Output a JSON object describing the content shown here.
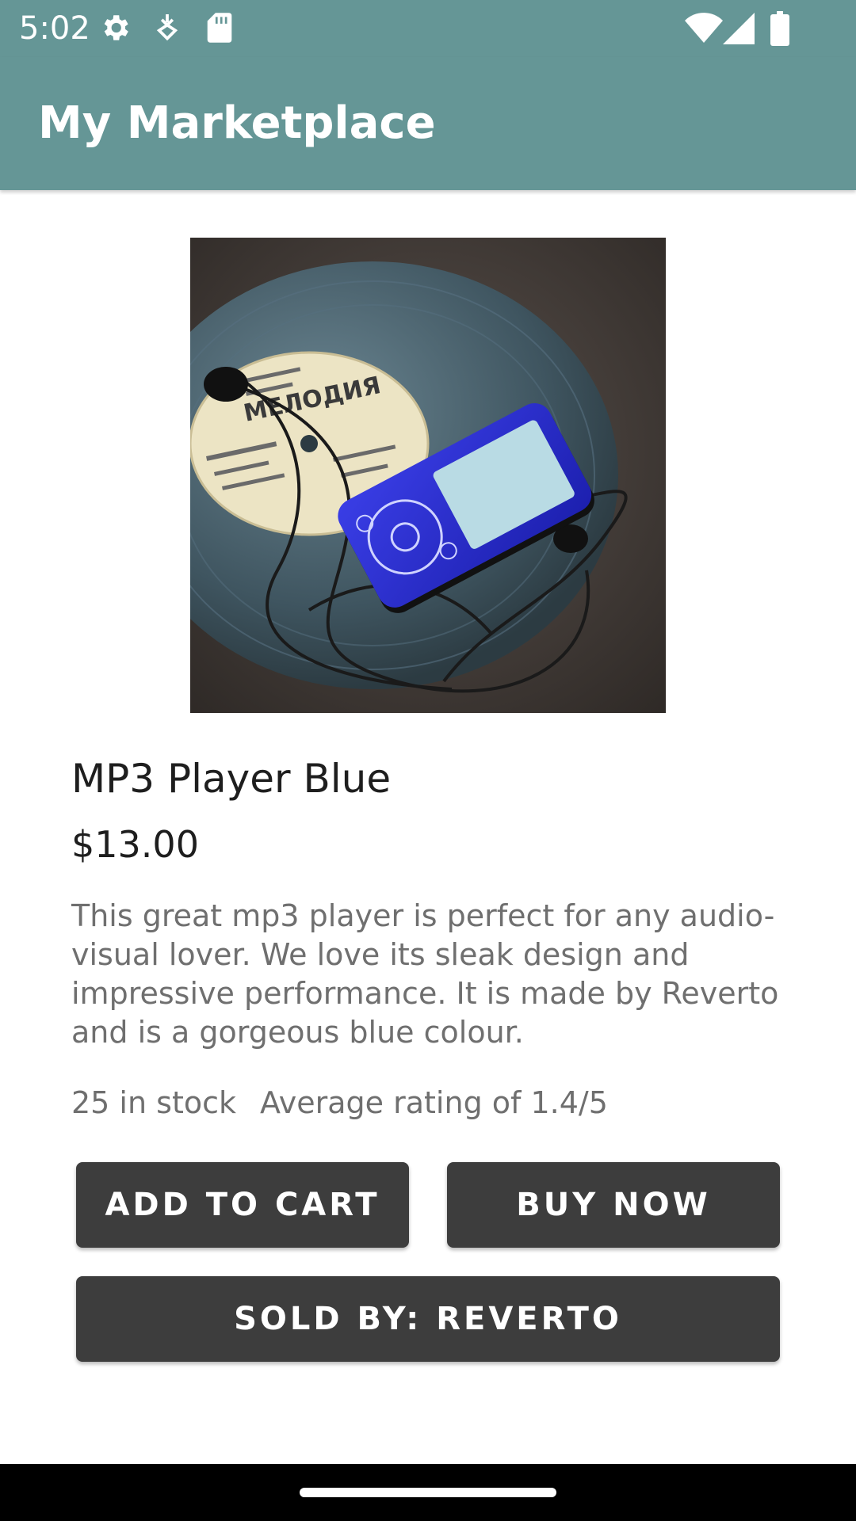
{
  "status_bar": {
    "time": "5:02",
    "icons_left": [
      "settings-gear-icon",
      "download-arrow-icon",
      "sd-card-icon"
    ],
    "icons_right": [
      "wifi-icon",
      "cellular-signal-icon",
      "battery-icon"
    ]
  },
  "app_bar": {
    "title": "My Marketplace",
    "color": "#659696"
  },
  "product": {
    "image_alt": "mp3-player-on-vinyl-record-image",
    "name": "MP3 Player Blue",
    "price": "$13.00",
    "description": "This great mp3 player is perfect for any audio-visual lover. We love its sleak design and impressive performance. It is made by Reverto and is a gorgeous blue colour.",
    "stock": "25 in stock",
    "rating": "Average rating of 1.4/5"
  },
  "actions": {
    "add_to_cart": "ADD TO CART",
    "buy_now": "BUY NOW",
    "sold_by": "SOLD BY: REVERTO",
    "button_color": "#3d3d3d"
  },
  "nav_bar": {
    "handle": "home-gesture-handle"
  }
}
